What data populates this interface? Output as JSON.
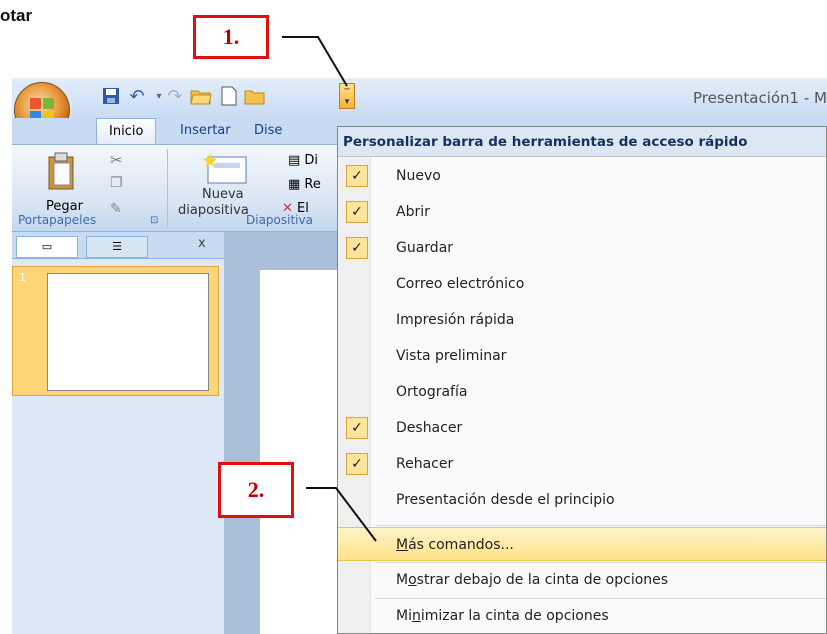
{
  "heading": "otar",
  "callouts": {
    "one": "1.",
    "two": "2."
  },
  "window": {
    "title": "Presentación1 - M",
    "tabs": [
      "Inicio",
      "Insertar",
      "Dise"
    ],
    "ribbon": {
      "paste_label": "Pegar",
      "new_slide_label_1": "Nueva",
      "new_slide_label_2": "diapositiva",
      "group_clipboard": "Portapapeles",
      "group_slides": "Diapositiva",
      "slide_btns": [
        "Di",
        "Re",
        "El"
      ]
    },
    "pane": {
      "slide_number": "1",
      "close": "x"
    }
  },
  "menu": {
    "header": "Personalizar barra de herramientas de acceso rápido",
    "items": [
      {
        "label": "Nuevo",
        "checked": true
      },
      {
        "label": "Abrir",
        "checked": true
      },
      {
        "label": "Guardar",
        "checked": true
      },
      {
        "label": "Correo electrónico",
        "checked": false
      },
      {
        "label": "Impresión rápida",
        "checked": false
      },
      {
        "label": "Vista preliminar",
        "checked": false
      },
      {
        "label": "Ortografía",
        "checked": false
      },
      {
        "label": "Deshacer",
        "checked": true
      },
      {
        "label": "Rehacer",
        "checked": true
      },
      {
        "label": "Presentación desde el principio",
        "checked": false
      }
    ],
    "more_commands": {
      "pre": "",
      "u": "M",
      "post": "ás comandos..."
    },
    "show_below": {
      "pre": "M",
      "u": "o",
      "post": "strar debajo de la cinta de opciones"
    },
    "minimize": {
      "pre": "Mi",
      "u": "n",
      "post": "imizar la cinta de opciones"
    }
  },
  "colors": {
    "accent": "#e01010",
    "highlight": "#ffe28a",
    "ribbon": "#c5d9f1"
  }
}
